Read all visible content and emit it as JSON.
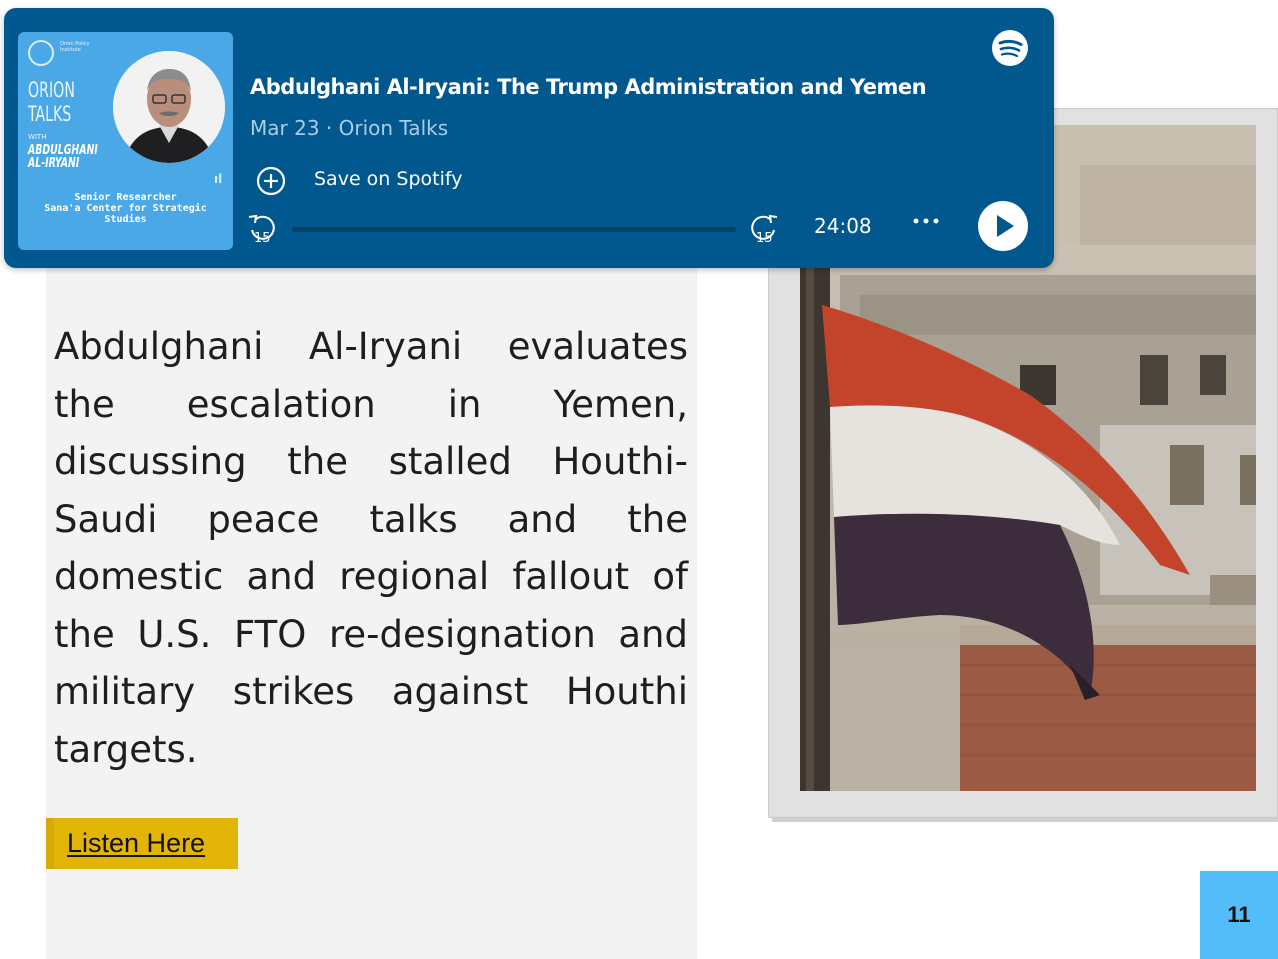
{
  "player": {
    "episode_title": "Abdulghani Al-Iryani: The Trump Administration and Yemen",
    "meta": "Mar 23 · Orion Talks",
    "save_label": "Save on Spotify",
    "duration": "24:08",
    "skip_back_seconds": "15",
    "skip_forward_seconds": "15",
    "progress": 0,
    "icons": [
      "spotify-icon",
      "save-plus-icon",
      "skip-back-15-icon",
      "skip-forward-15-icon",
      "more-icon",
      "play-icon"
    ],
    "colors": {
      "background": "#00588f",
      "text": "#ffffff",
      "meta": "#a9cde8"
    },
    "cover": {
      "org_name": "Orion Policy Institute",
      "show_line1": "ORION",
      "show_line2": "TALKS",
      "with_label": "WITH",
      "guest_line1": "ABDULGHANI",
      "guest_line2": "AL-IRYANI",
      "role_line1": "Senior Researcher",
      "role_line2": "Sana'a Center for Strategic",
      "role_line3": "Studies",
      "background": "#4aa8e7"
    }
  },
  "article": {
    "description": "Abdulghani Al-Iryani evaluates the escalation in Yemen, discussing the stalled Houthi-Saudi peace talks and the domestic and regional fallout of the U.S. FTO re-designation and military strikes against Houthi targets.",
    "link_label": "Listen Here",
    "link_color": "#e2b407"
  },
  "page": {
    "number": "11",
    "badge_color": "#52bdf8"
  }
}
